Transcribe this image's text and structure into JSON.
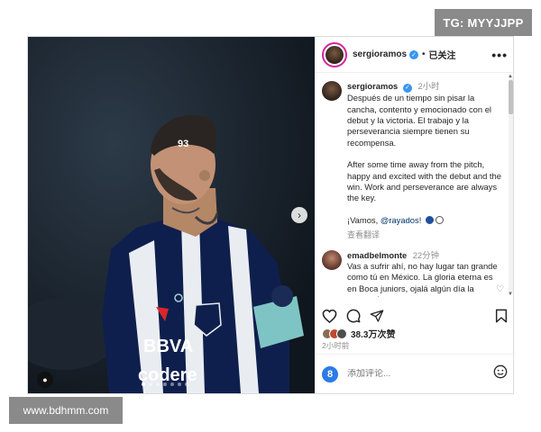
{
  "watermarks": {
    "top": "TG: MYYJJPP",
    "bottom": "www.bdhmm.com"
  },
  "photo": {
    "jersey_text": [
      "BBVA",
      "codere"
    ],
    "number": "93",
    "carousel_dots": 7,
    "active_dot": 1
  },
  "header": {
    "username": "sergioramos",
    "separator": "•",
    "follow_status": "已关注",
    "more_icon": "more-horizontal-icon"
  },
  "caption": {
    "username": "sergioramos",
    "time": "2小时",
    "text_es": "Después de un tiempo sin pisar la cancha, contento y emocionado con el debut y la victoria. El trabajo y la perseverancia siempre tienen su recompensa.",
    "text_en": "After some time away from the pitch, happy and excited with the debut and the win. Work and perseverance are always the key.",
    "closing_prefix": "¡Vamos, ",
    "closing_mention": "@rayados",
    "closing_suffix": "!",
    "see_translation": "查看翻译"
  },
  "comment": {
    "username": "emadbelmonte",
    "time": "22分钟",
    "text": "Vas a sufrir ahí, no hay lugar tan grande como tú en México. La gloria eterna es en Boca juniors, ojalá algún día la aproveches por"
  },
  "likes": {
    "count": "38.3万次赞"
  },
  "posted": "2小时前",
  "add_comment": {
    "placeholder": "添加评论...",
    "emoji_label": "8"
  },
  "colors": {
    "verified": "#3897f0",
    "mention": "#00376b",
    "emoji_button": "#2b7be8",
    "watermark_bg": "#8a8a8a"
  }
}
